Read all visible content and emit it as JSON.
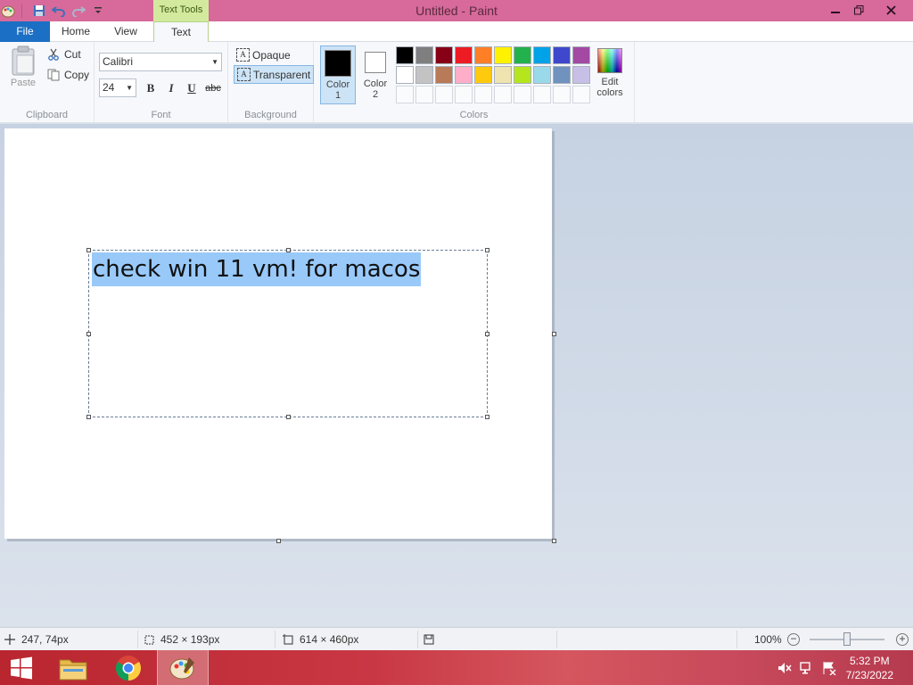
{
  "window": {
    "title": "Untitled - Paint",
    "contextual_tab_header": "Text Tools"
  },
  "tabs": {
    "file": "File",
    "home": "Home",
    "view": "View",
    "text": "Text"
  },
  "clipboard": {
    "paste": "Paste",
    "cut": "Cut",
    "copy": "Copy",
    "label": "Clipboard"
  },
  "font": {
    "family": "Calibri",
    "size": "24",
    "bold": "B",
    "italic": "I",
    "underline": "U",
    "strikethrough": "abc",
    "label": "Font"
  },
  "background": {
    "opaque": "Opaque",
    "transparent": "Transparent",
    "label": "Background",
    "selected": "transparent"
  },
  "colors": {
    "color1_label": "Color",
    "color1_num": "1",
    "color2_label": "Color",
    "color2_num": "2",
    "color1_value": "#000000",
    "color2_value": "#ffffff",
    "edit_label_1": "Edit",
    "edit_label_2": "colors",
    "label": "Colors",
    "palette": [
      "#000000",
      "#7f7f7f",
      "#880015",
      "#ed1c24",
      "#ff7f27",
      "#fff200",
      "#22b14c",
      "#00a2e8",
      "#3f48cc",
      "#a349a4",
      "#ffffff",
      "#c3c3c3",
      "#b97a57",
      "#ffaec9",
      "#ffc90e",
      "#efe4b0",
      "#b5e61d",
      "#99d9ea",
      "#7092be",
      "#c8bfe7"
    ],
    "empty_slots": 10
  },
  "canvas": {
    "text": "check win 11 vm! for macos",
    "selection_highlight": "#99c9f9"
  },
  "statusbar": {
    "cursor_pos": "247, 74px",
    "selection_size": "452 × 193px",
    "canvas_size": "614 × 460px",
    "zoom": "100%"
  },
  "taskbar": {
    "time": "5:32 PM",
    "date": "7/23/2022"
  }
}
